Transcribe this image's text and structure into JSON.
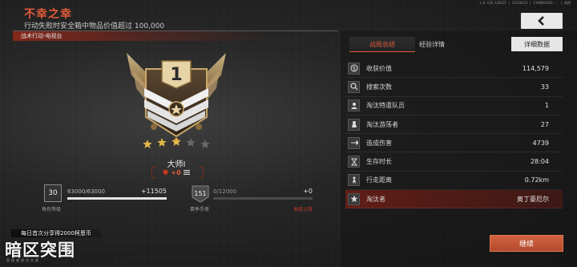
{
  "header": {
    "title": "不幸之幸",
    "subtitle": "行动失败时安全箱中物品价值超过 100,000",
    "mode": "战术行动-电视台",
    "top_info": "1.0.128.126615 | 16218124 | 1198863620... | 高德"
  },
  "rank": {
    "name": "大师Ⅰ",
    "badge_number": "1",
    "stars_filled": 3,
    "stars_total": 5,
    "delta": "+0"
  },
  "level": {
    "value": "30",
    "caption": "角色等级",
    "xp_text": "63000/63000",
    "xp_gain": "+11505",
    "progress": 1.0
  },
  "pass": {
    "value": "151",
    "caption": "赛季手册",
    "xp_text": "0/12000",
    "xp_gain": "+0",
    "limit_text": "本周上限",
    "progress": 0.0
  },
  "bonus_text": "每日首次分享得2000柯恩币",
  "logo": {
    "main": "暗区突围",
    "sub": "直接越战合本赛"
  },
  "tabs": [
    {
      "label": "战局总结",
      "active": true
    },
    {
      "label": "经验详情",
      "active": false
    }
  ],
  "detail_button": "详细数据",
  "stats": [
    {
      "icon": "value-icon",
      "label": "收获价值",
      "value": "114,579",
      "highlight": false
    },
    {
      "icon": "search-icon",
      "label": "搜索次数",
      "value": "33",
      "highlight": false
    },
    {
      "icon": "special-squad-icon",
      "label": "淘汰特遣队员",
      "value": "1",
      "highlight": false
    },
    {
      "icon": "wanderer-icon",
      "label": "淘汰游荡者",
      "value": "27",
      "highlight": false
    },
    {
      "icon": "damage-icon",
      "label": "造成伤害",
      "value": "4739",
      "highlight": false
    },
    {
      "icon": "hourglass-icon",
      "label": "生存时长",
      "value": "28:04",
      "highlight": false
    },
    {
      "icon": "distance-icon",
      "label": "行走距离",
      "value": "0.72km",
      "highlight": false
    },
    {
      "icon": "killer-icon",
      "label": "淘汰者",
      "value": "奥丁豪厄尔",
      "highlight": true
    }
  ],
  "continue_button": "继续",
  "colors": {
    "accent": "#e35b3a",
    "highlight_row": "#7a1e14",
    "button": "#c45535"
  }
}
